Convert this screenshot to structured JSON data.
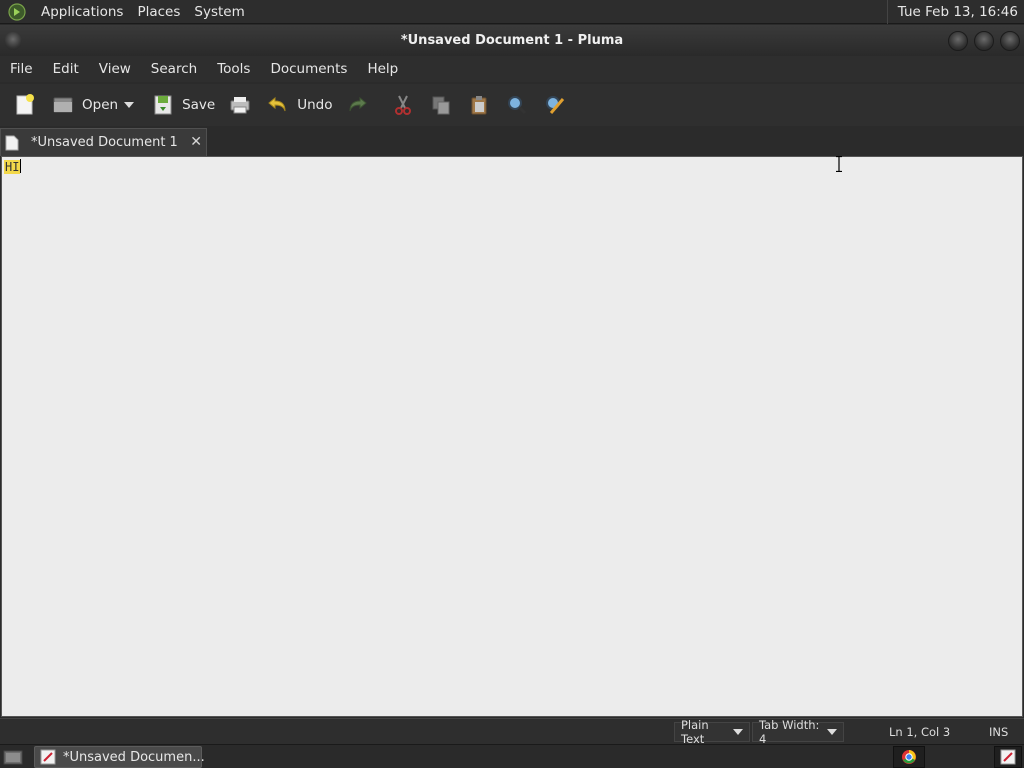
{
  "top_panel": {
    "menus": [
      "Applications",
      "Places",
      "System"
    ],
    "clock": "Tue Feb 13, 16:46"
  },
  "window": {
    "title": "*Unsaved Document 1 - Pluma"
  },
  "menubar": {
    "items": [
      "File",
      "Edit",
      "View",
      "Search",
      "Tools",
      "Documents",
      "Help"
    ]
  },
  "toolbar": {
    "open_label": "Open",
    "save_label": "Save",
    "undo_label": "Undo"
  },
  "tabs": [
    {
      "label": "*Unsaved Document 1",
      "close": "✕"
    }
  ],
  "editor": {
    "text": "HI"
  },
  "statusbar": {
    "language": "Plain Text",
    "tab_width": "Tab Width: 4",
    "position": "Ln 1, Col 3",
    "mode": "INS"
  },
  "taskbar": {
    "task_label": "*Unsaved Documen..."
  },
  "colors": {
    "highlight": "#f2d84a",
    "editor_bg": "#ececec",
    "chrome_bg": "#2e2e2e"
  }
}
